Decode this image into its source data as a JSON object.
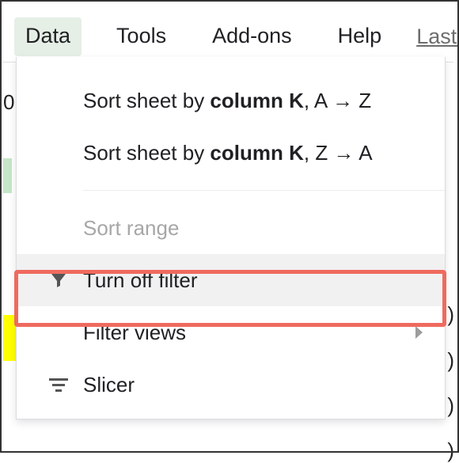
{
  "menubar": {
    "data": "Data",
    "tools": "Tools",
    "addons": "Add-ons",
    "help": "Help",
    "lastedit": "Last e"
  },
  "dropdown": {
    "sort_asc_prefix": "Sort sheet by ",
    "sort_asc_col": "column K",
    "sort_asc_suffix": ", A → Z",
    "sort_desc_prefix": "Sort sheet by ",
    "sort_desc_col": "column K",
    "sort_desc_suffix": ", Z → A",
    "sort_range": "Sort range",
    "turn_off_filter": "Turn off filter",
    "filter_views": "Filter views",
    "slicer": "Slicer"
  },
  "bg": {
    "zero": "0",
    "paren": ")"
  }
}
